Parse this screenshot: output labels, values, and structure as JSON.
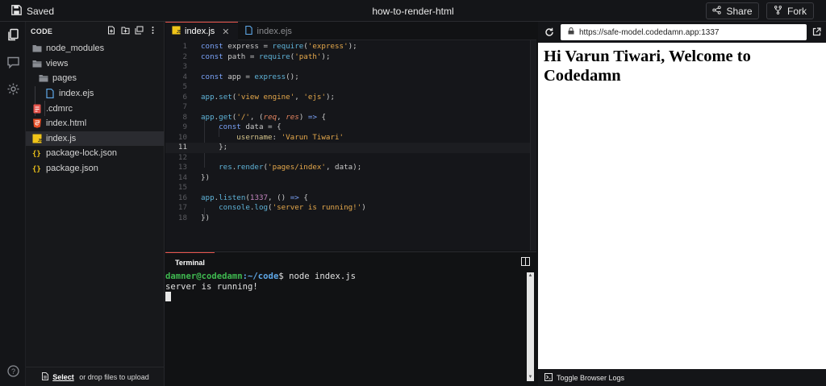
{
  "topbar": {
    "saved_label": "Saved",
    "project_title": "how-to-render-html",
    "share_label": "Share",
    "fork_label": "Fork"
  },
  "explorer": {
    "header": "CODE",
    "items": [
      {
        "label": "node_modules",
        "icon": "folder-icon"
      },
      {
        "label": "views",
        "icon": "folder-open-icon"
      },
      {
        "label": "pages",
        "icon": "folder-open-icon"
      },
      {
        "label": "index.ejs",
        "icon": "file-icon"
      },
      {
        "label": ".cdmrc",
        "icon": "config-file-icon"
      },
      {
        "label": "index.html",
        "icon": "html5-icon"
      },
      {
        "label": "index.js",
        "icon": "js-file-icon"
      },
      {
        "label": "package-lock.json",
        "icon": "json-icon"
      },
      {
        "label": "package.json",
        "icon": "json-icon"
      }
    ],
    "upload_select": "Select",
    "upload_rest": " or drop files to upload"
  },
  "editor": {
    "tabs": [
      {
        "label": "index.js",
        "icon": "JS"
      },
      {
        "label": "index.ejs",
        "icon": "file-icon"
      }
    ],
    "current_line": 11
  },
  "terminal": {
    "tab_label": "Terminal",
    "user": "damner@codedamn",
    "path": ":~/code",
    "prompt_tail": "$ node index.js",
    "output": "server is running!"
  },
  "preview": {
    "url": "https://safe-model.codedamn.app:1337",
    "heading": "Hi Varun Tiwari, Welcome to Codedamn",
    "logs_label": "Toggle Browser Logs"
  },
  "colors": {
    "accent": "#e5534b",
    "js_yellow": "#f0c419",
    "html_orange": "#e44d26",
    "folder_gray": "#8a8d93"
  }
}
